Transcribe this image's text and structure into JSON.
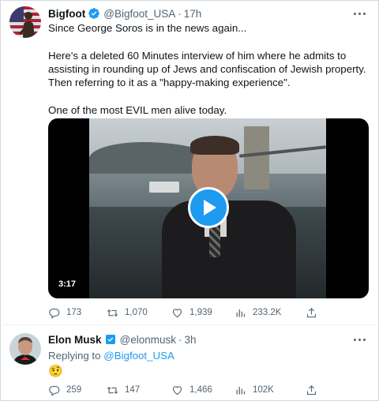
{
  "colors": {
    "accent": "#1d9bf0",
    "muted": "#536471",
    "text": "#0f1419",
    "border": "#cfd9de"
  },
  "tweet1": {
    "author_name": "Bigfoot",
    "handle": "@Bigfoot_USA",
    "separator": "·",
    "time": "17h",
    "verified_icon": "verified-badge-icon",
    "body_lines": [
      "Since George Soros is in the news again...",
      "",
      "Here's a deleted 60 Minutes interview of him where he admits to assisting in rounding up of Jews and confiscation of Jewish property.  Then referring to it as a \"happy-making experience\".",
      "",
      "One of the most EVIL men alive today."
    ],
    "video": {
      "duration": "3:17",
      "play_icon": "play-icon"
    },
    "actions": {
      "replies": "173",
      "retweets": "1,070",
      "likes": "1,939",
      "views": "233.2K"
    }
  },
  "tweet2": {
    "author_name": "Elon Musk",
    "handle": "@elonmusk",
    "separator": "·",
    "time": "3h",
    "verified_icon": "verified-badge-icon",
    "replying_prefix": "Replying to",
    "replying_to": "@Bigfoot_USA",
    "emoji": "🤨",
    "actions": {
      "replies": "259",
      "retweets": "147",
      "likes": "1,466",
      "views": "102K"
    }
  }
}
